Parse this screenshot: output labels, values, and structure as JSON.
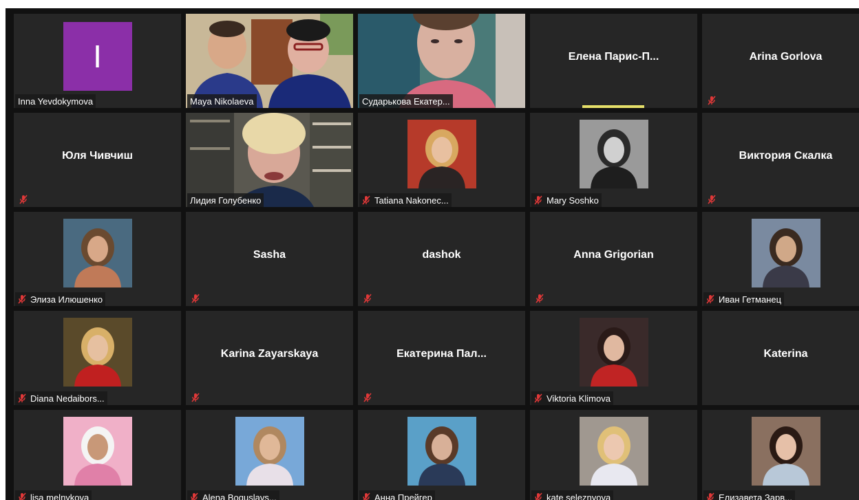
{
  "meeting": {
    "participants": [
      {
        "name": "Inna Yevdokymova",
        "initial": "I",
        "type": "initial",
        "muted": false
      },
      {
        "name": "Maya Nikolaeva",
        "type": "video-two",
        "muted": false,
        "speaking": true
      },
      {
        "name": "Сударькова Екатер...",
        "type": "video-face",
        "muted": false
      },
      {
        "name": "Елена  Парис-П...",
        "type": "name-only",
        "muted": false,
        "speaker_bar": true
      },
      {
        "name": "Arina Gorlova",
        "type": "name-only",
        "muted": true
      },
      {
        "name": "Юля Чивчиш",
        "type": "name-only",
        "muted": true
      },
      {
        "name": "Лидия Голубенко",
        "type": "video-shelf",
        "muted": false
      },
      {
        "name": "Tatiana Nakonec...",
        "type": "photo",
        "photo_style": "blonde-red",
        "muted": true
      },
      {
        "name": "Mary Soshko",
        "type": "photo",
        "photo_style": "bw",
        "muted": true
      },
      {
        "name": "Виктория Скалка",
        "type": "name-only",
        "muted": true
      },
      {
        "name": "Элиза Илюшенко",
        "type": "photo",
        "photo_style": "stadium",
        "muted": true
      },
      {
        "name": "Sasha",
        "type": "name-only",
        "muted": true
      },
      {
        "name": "dashok",
        "type": "name-only",
        "muted": true
      },
      {
        "name": "Anna Grigorian",
        "type": "name-only",
        "muted": true
      },
      {
        "name": "Иван Гетманец",
        "type": "photo",
        "photo_style": "room",
        "muted": true
      },
      {
        "name": "Diana Nedaibors...",
        "type": "photo",
        "photo_style": "red-jacket",
        "muted": true
      },
      {
        "name": "Karina Zayarskaya",
        "type": "name-only",
        "muted": true
      },
      {
        "name": "Екатерина  Пал...",
        "type": "name-only",
        "muted": true
      },
      {
        "name": "Viktoria Klimova",
        "type": "photo",
        "photo_style": "red-plaid",
        "muted": true
      },
      {
        "name": "Katerina",
        "type": "name-only",
        "muted": false
      },
      {
        "name": "lisa melnykova",
        "type": "photo",
        "photo_style": "dog",
        "muted": true
      },
      {
        "name": "Alena Boguslavs...",
        "type": "photo",
        "photo_style": "venice",
        "muted": true
      },
      {
        "name": "Анна Прейгер",
        "type": "photo",
        "photo_style": "lake",
        "muted": true
      },
      {
        "name": "kate seleznyova",
        "type": "photo",
        "photo_style": "blonde-stripes",
        "muted": true
      },
      {
        "name": "Елизавета Зарв...",
        "type": "photo",
        "photo_style": "dark-hair",
        "muted": true
      }
    ]
  },
  "colors": {
    "tile_bg": "#262626",
    "gallery_bg": "#111111",
    "speaker_highlight": "#e6e06a",
    "mute_icon": "#e03838",
    "avatar_initial_bg": "#8b2fa8"
  },
  "icons": {
    "mute": "microphone-muted-icon"
  }
}
